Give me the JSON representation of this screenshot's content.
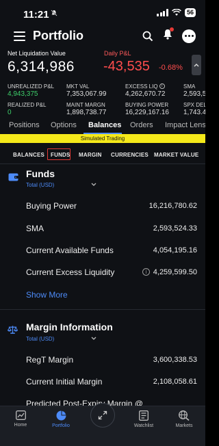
{
  "status_bar": {
    "time": "11:21",
    "battery": "56"
  },
  "header": {
    "title": "Portfolio"
  },
  "summary": {
    "net_liquidation_label": "Net Liquidation Value",
    "net_liquidation_value": "6,314,986",
    "daily_pl_label": "Daily P&L",
    "daily_pl_value": "-43,535",
    "daily_pl_pct": "-0.68%",
    "metrics": [
      {
        "label": "UNREALIZED P&L",
        "value": "4,943,375"
      },
      {
        "label": "MKT VAL",
        "value": "7,353,067.99"
      },
      {
        "label": "EXCESS LIQ",
        "value": "4,262,670.72"
      },
      {
        "label": "SMA",
        "value": "2,593,5"
      },
      {
        "label": "REALIZED P&L",
        "value": "0"
      },
      {
        "label": "MAINT MARGN",
        "value": "1,898,738.77"
      },
      {
        "label": "BUYING POWER",
        "value": "16,229,167.16"
      },
      {
        "label": "SPX DELT",
        "value": "1,743.4"
      }
    ]
  },
  "tabs": [
    "Positions",
    "Options",
    "Balances",
    "Orders",
    "Impact Lens"
  ],
  "active_tab": "Balances",
  "banner": "Simulated Trading",
  "subtabs": [
    "BALANCES",
    "FUNDS",
    "MARGIN",
    "CURRENCIES",
    "MARKET VALUE"
  ],
  "funds": {
    "title": "Funds",
    "currency": "Total (USD)",
    "rows": [
      {
        "label": "Buying Power",
        "value": "16,216,780.62"
      },
      {
        "label": "SMA",
        "value": "2,593,524.33"
      },
      {
        "label": "Current Available Funds",
        "value": "4,054,195.16"
      },
      {
        "label": "Current Excess Liquidity",
        "value": "4,259,599.50"
      }
    ],
    "show_more": "Show More"
  },
  "margin": {
    "title": "Margin Information",
    "currency": "Total (USD)",
    "rows": [
      {
        "label": "RegT Margin",
        "value": "3,600,338.53"
      },
      {
        "label": "Current Initial Margin",
        "value": "2,108,058.61"
      },
      {
        "label": "Predicted Post-Expiry Margin @",
        "value": ""
      }
    ]
  },
  "bottom_nav": [
    {
      "label": "Home",
      "icon": "home-chart-icon"
    },
    {
      "label": "Portfolio",
      "icon": "pie-chart-icon"
    },
    {
      "label": "Watchlist",
      "icon": "watchlist-icon"
    },
    {
      "label": "Markets",
      "icon": "globe-search-icon"
    }
  ],
  "colors": {
    "accent": "#4d8bf8",
    "negative": "#ff4d4d",
    "positive": "#3ecf6a",
    "banner": "#f5e91a",
    "highlight_box": "#e53935"
  }
}
